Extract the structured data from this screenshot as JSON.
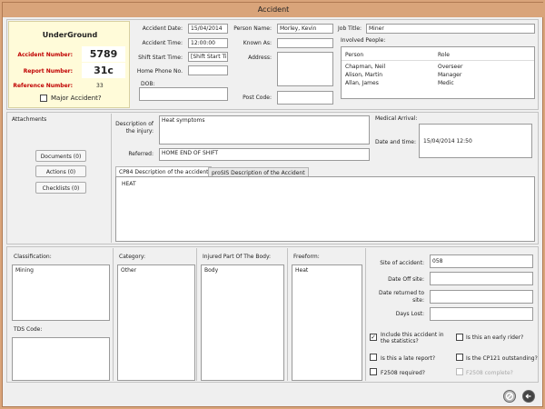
{
  "window": {
    "title": "Accident"
  },
  "company": {
    "name": "UnderGround"
  },
  "numbers": [
    {
      "label": "Accident Number:",
      "value": "5789"
    },
    {
      "label": "Report Number:",
      "value": "31c"
    },
    {
      "label": "Reference Number:",
      "value": "33"
    }
  ],
  "major_accident": {
    "label": "Major Accident?",
    "checked": false
  },
  "accident_info": {
    "date_label": "Accident Date:",
    "date": "15/04/2014",
    "time_label": "Accident Time:",
    "time": "12:00:00",
    "shift_label": "Shift Start Time:",
    "shift": "[Shift Start Ti",
    "home_phone_label": "Home Phone No.",
    "home_phone": "",
    "dob_label": "DOB:",
    "dob": ""
  },
  "person": {
    "name_label": "Person Name:",
    "name": "Morley, Kevin",
    "known_as_label": "Known As:",
    "known_as": "",
    "address_label": "Address:",
    "address": "",
    "post_code_label": "Post Code:",
    "post_code": "",
    "job_title_label": "Job Title:",
    "job_title": "Miner"
  },
  "involved": {
    "label": "Involved People:",
    "columns": [
      "Person",
      "Role"
    ],
    "rows": [
      {
        "person": "Chapman, Neil",
        "role": "Overseer"
      },
      {
        "person": "Alison, Martin",
        "role": "Manager"
      },
      {
        "person": "Allan, James",
        "role": "Medic"
      }
    ]
  },
  "attachments": {
    "label": "Attachments",
    "buttons": [
      "Documents (0)",
      "Actions (0)",
      "Checklists (0)"
    ]
  },
  "injury": {
    "description_label": "Description of the injury:",
    "description": "Heat symptoms",
    "referred_label": "Referred:",
    "referred": "HOME END OF SHIFT"
  },
  "medical": {
    "label": "Medical Arrival:",
    "datetime_label": "Date and time:",
    "datetime": "15/04/2014 12:50"
  },
  "tabs": [
    {
      "label": "CP84 Description of the accident",
      "active": true
    },
    {
      "label": "proSIS Description of the Accident",
      "active": false
    }
  ],
  "description_text": "HEAT",
  "classification": {
    "label": "Classification:",
    "items": [
      "Mining"
    ]
  },
  "tds": {
    "label": "TDS Code:"
  },
  "category": {
    "label": "Category:",
    "items": [
      "Other"
    ]
  },
  "body_part": {
    "label": "Injured Part Of The Body:",
    "items": [
      "Body"
    ]
  },
  "freeform": {
    "label": "Freeform:",
    "items": [
      "Heat"
    ]
  },
  "site": {
    "site_label": "Site of accident:",
    "site": "058",
    "date_off_label": "Date Off site:",
    "date_off": "",
    "date_returned_label": "Date returned to site:",
    "date_returned": "",
    "days_lost_label": "Days Lost:",
    "days_lost": ""
  },
  "checks": [
    {
      "label": "Include this accident in the statistics?",
      "checked": true,
      "enabled": true
    },
    {
      "label": "Is this an early rider?",
      "checked": false,
      "enabled": true
    },
    {
      "label": "Is this a late report?",
      "checked": false,
      "enabled": true
    },
    {
      "label": "Is the CP121 outstanding?",
      "checked": false,
      "enabled": true
    },
    {
      "label": "F2508 required?",
      "checked": false,
      "enabled": true
    },
    {
      "label": "F2508 complete?",
      "checked": false,
      "enabled": false
    }
  ],
  "footer": {
    "icons": [
      "cancel-icon",
      "back-icon"
    ]
  }
}
